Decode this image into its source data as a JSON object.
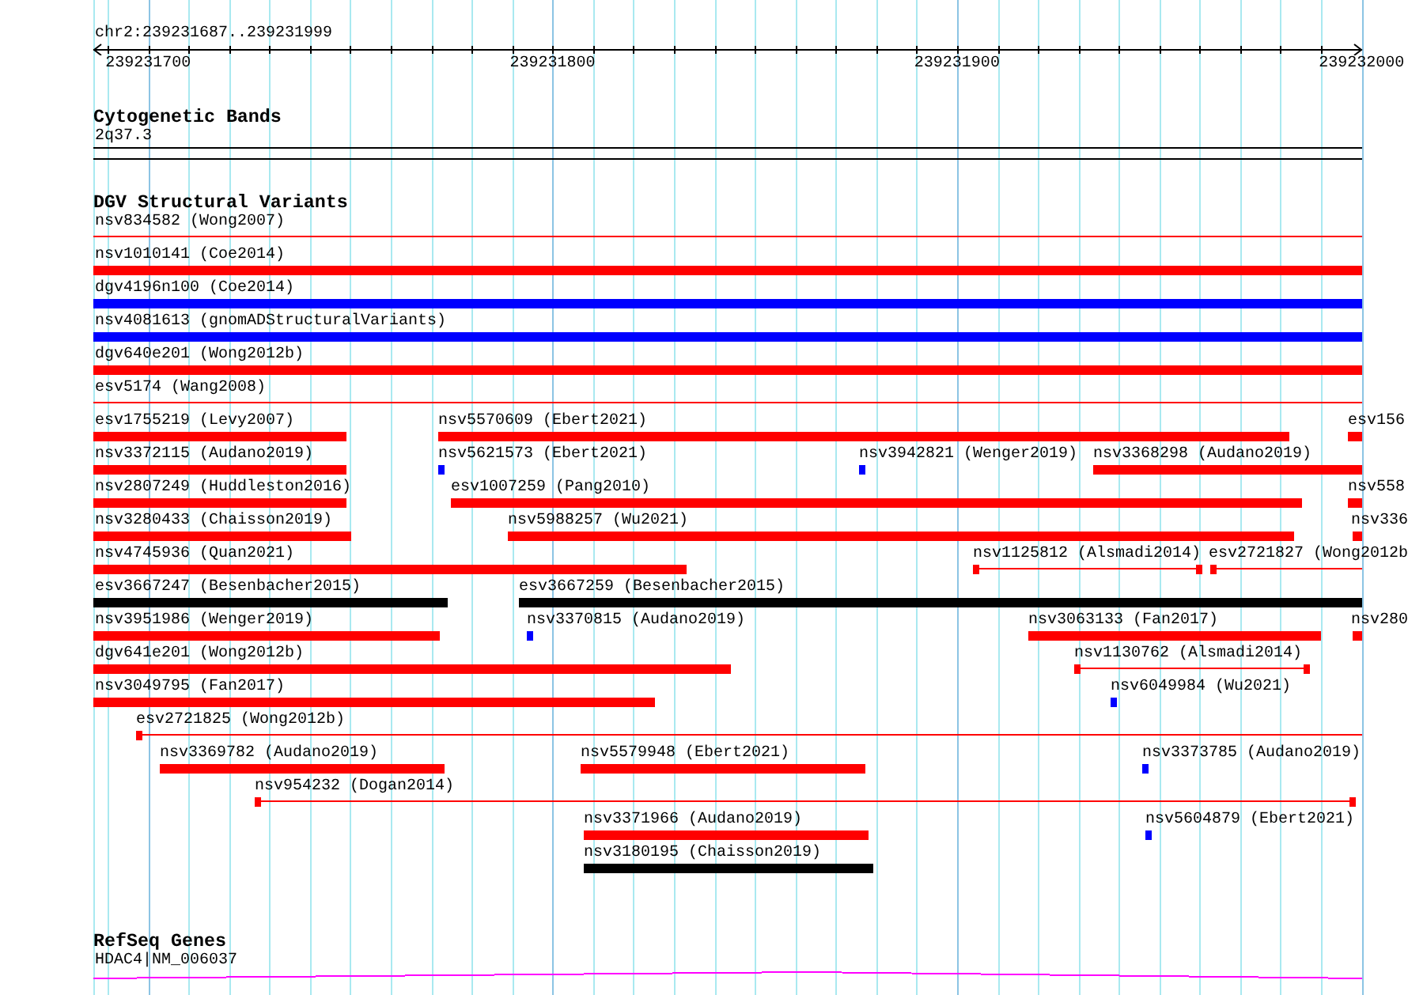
{
  "ruler": {
    "region": "chr2:239231687..239231999",
    "ticks": [
      "239231700",
      "239231800",
      "239231900",
      "239232000"
    ]
  },
  "tracks": [
    {
      "kind": "cytoband",
      "title": "Cytogenetic Bands",
      "features": [
        {
          "label": "2q37.3"
        }
      ]
    },
    {
      "kind": "variants",
      "title": "DGV Structural Variants",
      "rows": [
        {
          "features": [
            {
              "label": "nsv834582 (Wong2007)",
              "kind": "line",
              "color": "#ff0000"
            }
          ]
        },
        {
          "features": [
            {
              "label": "nsv1010141 (Coe2014)",
              "kind": "bar",
              "color": "#ff0000"
            }
          ]
        },
        {
          "features": [
            {
              "label": "dgv4196n100 (Coe2014)",
              "kind": "bar",
              "color": "#0000ff"
            }
          ]
        },
        {
          "features": [
            {
              "label": "nsv4081613 (gnomADStructuralVariants)",
              "kind": "bar",
              "color": "#0000ff"
            }
          ]
        },
        {
          "features": [
            {
              "label": "dgv640e201 (Wong2012b)",
              "kind": "bar",
              "color": "#ff0000"
            }
          ]
        },
        {
          "features": [
            {
              "label": "esv5174 (Wang2008)",
              "kind": "line",
              "color": "#ff0000"
            }
          ]
        },
        {
          "features": [
            {
              "label": "esv1755219 (Levy2007)",
              "kind": "bar",
              "color": "#ff0000"
            },
            {
              "label": "nsv5570609 (Ebert2021)",
              "kind": "bar",
              "color": "#ff0000"
            },
            {
              "label": "esv156",
              "kind": "bar",
              "color": "#ff0000"
            }
          ]
        },
        {
          "features": [
            {
              "label": "nsv3372115 (Audano2019)",
              "kind": "bar",
              "color": "#ff0000"
            },
            {
              "label": "nsv5621573 (Ebert2021)",
              "kind": "bar",
              "color": "#0000ff"
            },
            {
              "label": "nsv3942821 (Wenger2019)",
              "kind": "bar",
              "color": "#0000ff"
            },
            {
              "label": "nsv3368298 (Audano2019)",
              "kind": "bar",
              "color": "#ff0000"
            }
          ]
        },
        {
          "features": [
            {
              "label": "nsv2807249 (Huddleston2016)",
              "kind": "bar",
              "color": "#ff0000"
            },
            {
              "label": "esv1007259 (Pang2010)",
              "kind": "bar",
              "color": "#ff0000"
            },
            {
              "label": "nsv558",
              "kind": "bar",
              "color": "#ff0000"
            }
          ]
        },
        {
          "features": [
            {
              "label": "nsv3280433 (Chaisson2019)",
              "kind": "bar",
              "color": "#ff0000"
            },
            {
              "label": "nsv5988257 (Wu2021)",
              "kind": "bar",
              "color": "#ff0000"
            },
            {
              "label": "nsv336",
              "kind": "bar",
              "color": "#ff0000"
            }
          ]
        },
        {
          "features": [
            {
              "label": "nsv4745936 (Quan2021)",
              "kind": "bar",
              "color": "#ff0000"
            },
            {
              "label": "nsv1125812 (Alsmadi2014)",
              "kind": "line",
              "color": "#ff0000"
            },
            {
              "label": "esv2721827 (Wong2012b",
              "kind": "line",
              "color": "#ff0000"
            }
          ]
        },
        {
          "features": [
            {
              "label": "esv3667247 (Besenbacher2015)",
              "kind": "bar",
              "color": "#000000"
            },
            {
              "label": "esv3667259 (Besenbacher2015)",
              "kind": "bar",
              "color": "#000000"
            }
          ]
        },
        {
          "features": [
            {
              "label": "nsv3951986 (Wenger2019)",
              "kind": "bar",
              "color": "#ff0000"
            },
            {
              "label": "nsv3370815 (Audano2019)",
              "kind": "bar",
              "color": "#0000ff"
            },
            {
              "label": "nsv3063133 (Fan2017)",
              "kind": "bar",
              "color": "#ff0000"
            },
            {
              "label": "nsv280",
              "kind": "bar",
              "color": "#ff0000"
            }
          ]
        },
        {
          "features": [
            {
              "label": "dgv641e201 (Wong2012b)",
              "kind": "bar",
              "color": "#ff0000"
            },
            {
              "label": "nsv1130762 (Alsmadi2014)",
              "kind": "line",
              "color": "#ff0000"
            }
          ]
        },
        {
          "features": [
            {
              "label": "nsv3049795 (Fan2017)",
              "kind": "bar",
              "color": "#ff0000"
            },
            {
              "label": "nsv6049984 (Wu2021)",
              "kind": "bar",
              "color": "#0000ff"
            }
          ]
        },
        {
          "features": [
            {
              "label": "esv2721825 (Wong2012b)",
              "kind": "line",
              "color": "#ff0000"
            }
          ]
        },
        {
          "features": [
            {
              "label": "nsv3369782 (Audano2019)",
              "kind": "bar",
              "color": "#ff0000"
            },
            {
              "label": "nsv5579948 (Ebert2021)",
              "kind": "bar",
              "color": "#ff0000"
            },
            {
              "label": "nsv3373785 (Audano2019)",
              "kind": "bar",
              "color": "#0000ff"
            }
          ]
        },
        {
          "features": [
            {
              "label": "nsv954232 (Dogan2014)",
              "kind": "line",
              "color": "#ff0000"
            }
          ]
        },
        {
          "features": [
            {
              "label": "nsv3371966 (Audano2019)",
              "kind": "bar",
              "color": "#ff0000"
            },
            {
              "label": "nsv5604879 (Ebert2021)",
              "kind": "bar",
              "color": "#0000ff"
            }
          ]
        },
        {
          "features": [
            {
              "label": "nsv3180195 (Chaisson2019)",
              "kind": "bar",
              "color": "#000000"
            }
          ]
        }
      ]
    },
    {
      "kind": "genes",
      "title": "RefSeq Genes",
      "features": [
        {
          "label": "HDAC4|NM_006037"
        }
      ]
    }
  ]
}
